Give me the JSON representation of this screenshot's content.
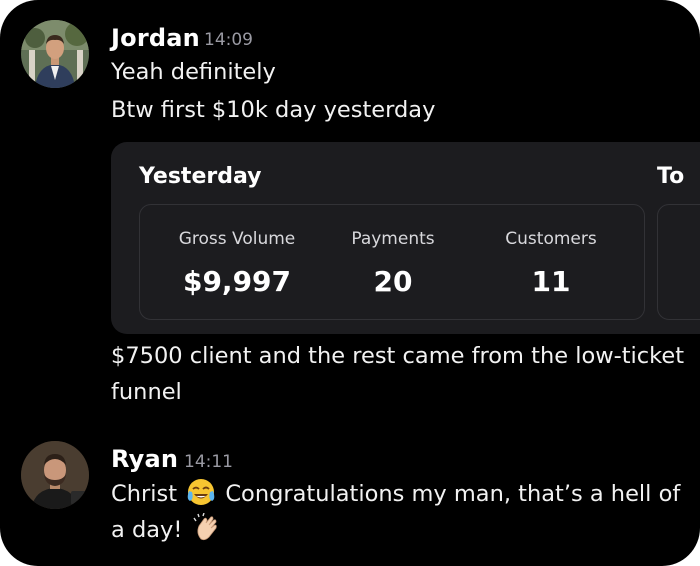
{
  "messages": [
    {
      "username": "Jordan",
      "time": "14:09",
      "avatar": "avatar-jordan",
      "lines": [
        "Yeah definitely",
        "Btw first $10k day yesterday"
      ],
      "card": {
        "title": "Yesterday",
        "title_2": "To",
        "stats": [
          {
            "label": "Gross Volume",
            "value": "$9,997"
          },
          {
            "label": "Payments",
            "value": "20"
          },
          {
            "label": "Customers",
            "value": "11"
          }
        ]
      },
      "followup_lines": [
        "$7500 client and the rest came from the low-ticket",
        "funnel"
      ]
    },
    {
      "username": "Ryan",
      "time": "14:11",
      "avatar": "avatar-ryan",
      "line1_a": "Christ",
      "emoji_1": "tears-of-joy-emoji",
      "line1_b": "Congratulations my man, that’s a hell of",
      "line2_a": "a day!",
      "emoji_2": "clapping-hands-emoji"
    }
  ],
  "colors": {
    "background": "#000000",
    "card": "#1c1c1f",
    "timestamp": "#9a9aa3",
    "text": "#f2f2f2"
  }
}
